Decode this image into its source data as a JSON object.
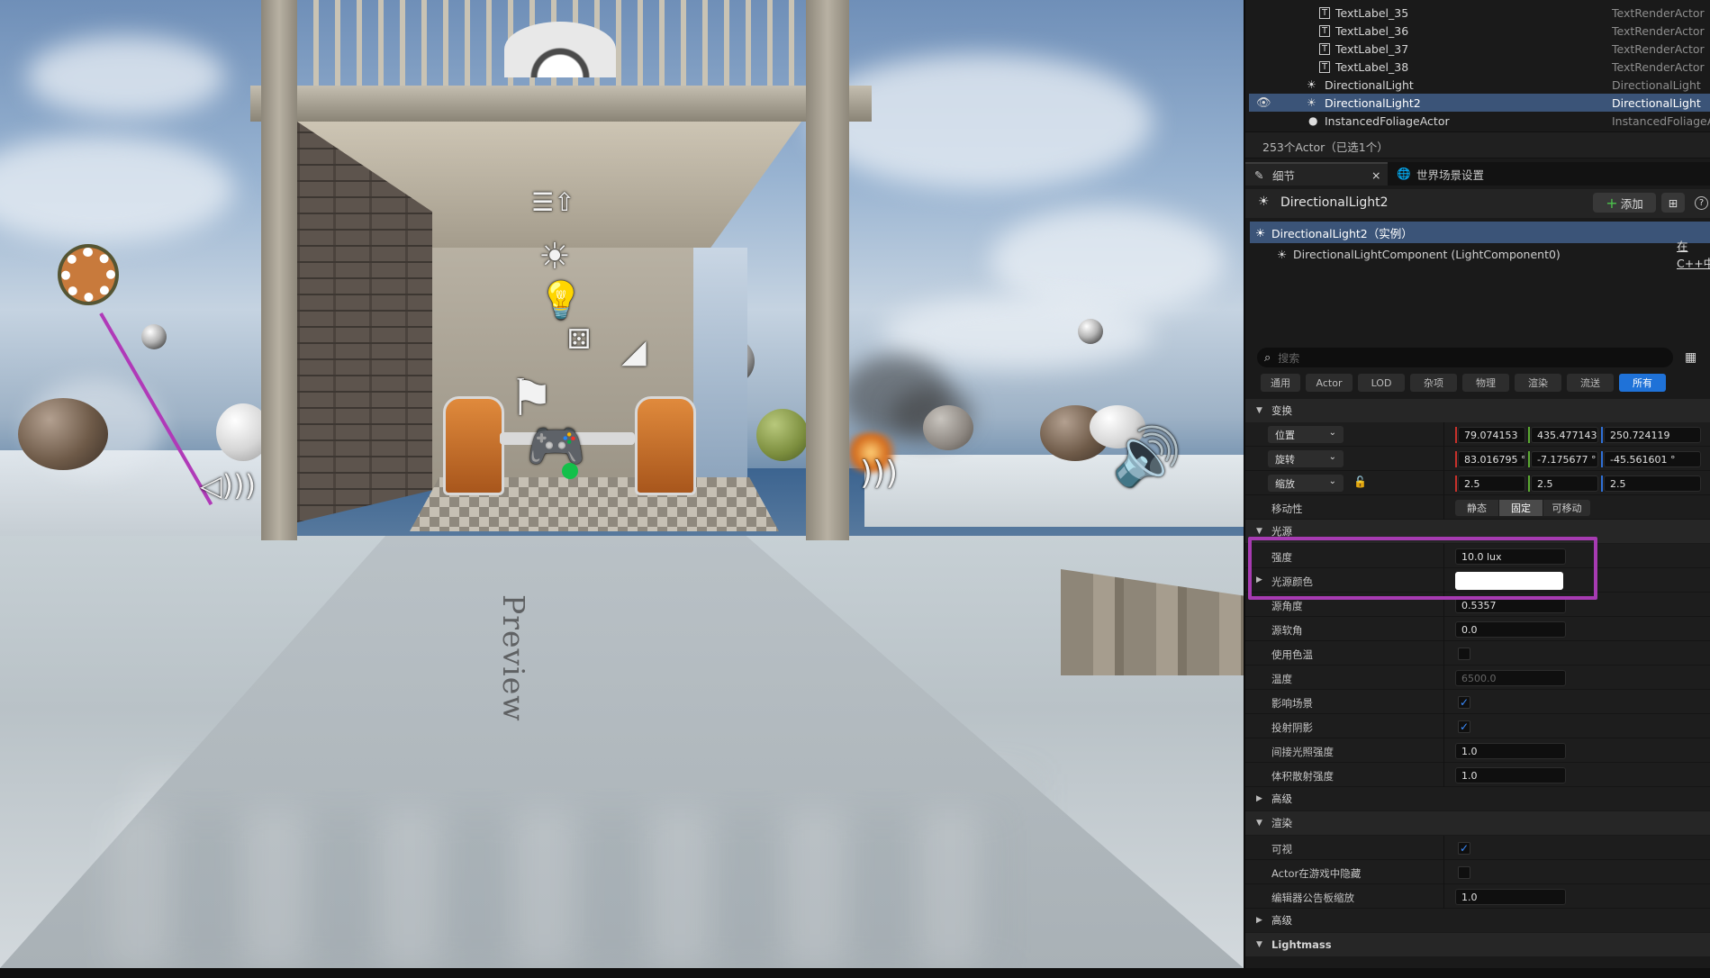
{
  "viewport": {
    "preview_text": "Preview"
  },
  "outliner": {
    "rows": [
      {
        "icon": "T",
        "name": "TextLabel_35",
        "type": "TextRenderActor"
      },
      {
        "icon": "T",
        "name": "TextLabel_36",
        "type": "TextRenderActor"
      },
      {
        "icon": "T",
        "name": "TextLabel_37",
        "type": "TextRenderActor"
      },
      {
        "icon": "T",
        "name": "TextLabel_38",
        "type": "TextRenderActor"
      },
      {
        "icon": "☀",
        "name": "DirectionalLight",
        "type": "DirectionalLight"
      },
      {
        "icon": "☀",
        "name": "DirectionalLight2",
        "type": "DirectionalLight",
        "selected": true
      },
      {
        "icon": "●",
        "name": "InstancedFoliageActor",
        "type": "InstancedFoliageActor"
      }
    ],
    "count_text": "253个Actor（已选1个）"
  },
  "tabs": {
    "details_label": "细节",
    "details_close": "×",
    "world_settings_label": "世界场景设置"
  },
  "details": {
    "title": "DirectionalLight2",
    "add_label": "添加",
    "add_plus": "+",
    "help_symbol": "?",
    "instance_label": "DirectionalLight2（实例）",
    "component_label": "DirectionalLightComponent (LightComponent0)",
    "cpp_link": "在C++中",
    "search_placeholder": "搜索",
    "filters": [
      "通用",
      "Actor",
      "LOD",
      "杂项",
      "物理",
      "渲染",
      "流送",
      "所有"
    ],
    "active_filter": "所有"
  },
  "sections": {
    "transform": "变换",
    "light": "光源",
    "advanced1": "高级",
    "rendering": "渲染",
    "advanced2": "高级",
    "lightmass": "Lightmass"
  },
  "transform": {
    "location_label": "位置",
    "location": [
      "79.074153",
      "435.477143",
      "250.724119"
    ],
    "rotation_label": "旋转",
    "rotation": [
      "83.016795 °",
      "-7.175677 °",
      "-45.561601 °"
    ],
    "scale_label": "缩放",
    "scale": [
      "2.5",
      "2.5",
      "2.5"
    ],
    "mobility_label": "移动性",
    "mobility_options": [
      "静态",
      "固定",
      "可移动"
    ],
    "mobility_selected": "固定"
  },
  "light": {
    "intensity_label": "强度",
    "intensity": "10.0 lux",
    "color_label": "光源颜色",
    "color": "#ffffff",
    "source_angle_label": "源角度",
    "source_angle": "0.5357",
    "source_soft_angle_label": "源软角",
    "source_soft_angle": "0.0",
    "use_temperature_label": "使用色温",
    "use_temperature": false,
    "temperature_label": "温度",
    "temperature": "6500.0",
    "affects_world_label": "影响场景",
    "affects_world": true,
    "cast_shadows_label": "投射阴影",
    "cast_shadows": true,
    "indirect_label": "间接光照强度",
    "indirect": "1.0",
    "volumetric_label": "体积散射强度",
    "volumetric": "1.0"
  },
  "rendering": {
    "visible_label": "可视",
    "visible": true,
    "hidden_in_game_label": "Actor在游戏中隐藏",
    "hidden_in_game": false,
    "billboard_label": "编辑器公告板缩放",
    "billboard": "1.0"
  },
  "colors": {
    "selection": "#3b5478",
    "accent_blue": "#1f72d8",
    "highlight_box": "#a73bb2",
    "axis_x": "#c8312b",
    "axis_y": "#5aa832",
    "axis_z": "#2f6fd6"
  }
}
